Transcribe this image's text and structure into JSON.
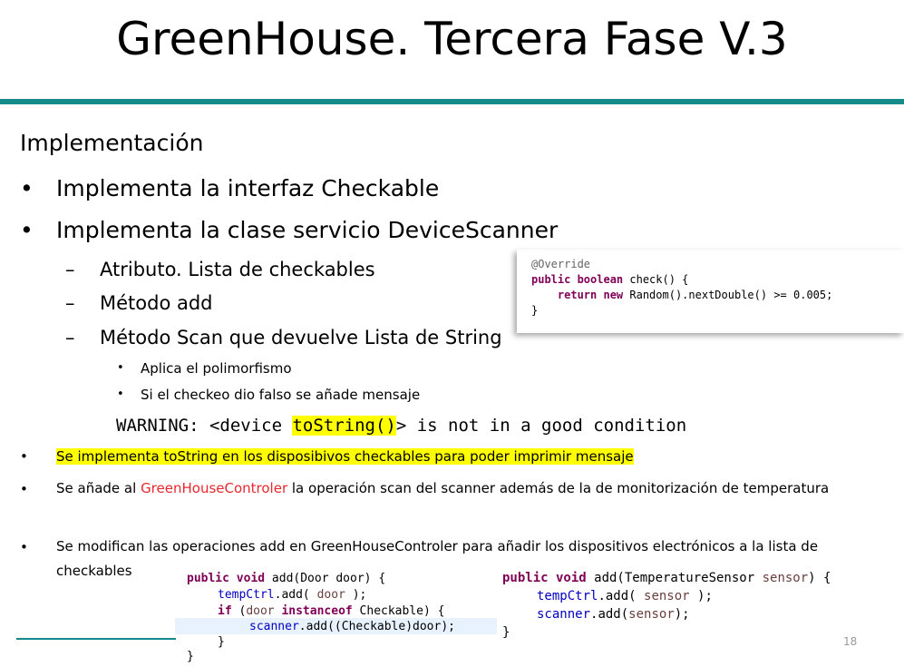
{
  "slide": {
    "title": "GreenHouse. Tercera Fase V.3",
    "heading": "Implementación",
    "bullets_l1": [
      "Implementa la interfaz Checkable",
      "Implementa la clase servicio DeviceScanner"
    ],
    "bullets_l2": [
      "Atributo. Lista de checkables",
      "Método add",
      "Método Scan que devuelve Lista de String"
    ],
    "bullets_l3": [
      "Aplica el polimorfismo",
      "Si el checkeo dio falso se añade mensaje"
    ],
    "warning": {
      "prefix": "WARNING: <device ",
      "highlight": "toString()",
      "suffix": "> is not in a good condition"
    },
    "para1": "Se implementa toString en los disposibivos checkables para poder imprimir mensaje",
    "para2": {
      "before": "Se añade al ",
      "red": "GreenHouseControler",
      "after": " la operación scan del scanner además de la de monitorización de temperatura"
    },
    "para3": "Se modifican las operaciones add en GreenHouseControler para añadir los dispositivos electrónicos a la lista de checkables",
    "page_number": "18",
    "bullet_symbol": "•",
    "dash_symbol": "–"
  },
  "code_override": {
    "l1": "@Override",
    "l2_kw": "public boolean",
    "l2_rest": " check() {",
    "l3_indent": "    ",
    "l3_kw": "return new",
    "l3_rest": " Random().nextDouble() >= 0.005;",
    "l4": "}"
  },
  "code_door": {
    "l1_kw": "public void",
    "l1_rest": " add(Door door) {",
    "l2_field": "tempCtrl",
    "l2_rest": ".add( ",
    "l2_var": "door",
    "l2_end": " );",
    "l3_kw": "if",
    "l3_a": " (",
    "l3_var": "door",
    "l3_kw2": " instanceof",
    "l3_rest": " Checkable) {",
    "l4_field": "scanner",
    "l4_rest": ".add((Checkable)door);",
    "l5": "}",
    "l6": "}"
  },
  "code_sensor": {
    "l1_kw": "public void",
    "l1_rest": " add(TemperatureSensor ",
    "l1_var": "sensor",
    "l1_end": ") {",
    "l2_field": "tempCtrl",
    "l2_rest": ".add( ",
    "l2_var": "sensor",
    "l2_end": " );",
    "l3_field": "scanner",
    "l3_rest": ".add(",
    "l3_var": "sensor",
    "l3_end": ");",
    "l4": "}"
  }
}
